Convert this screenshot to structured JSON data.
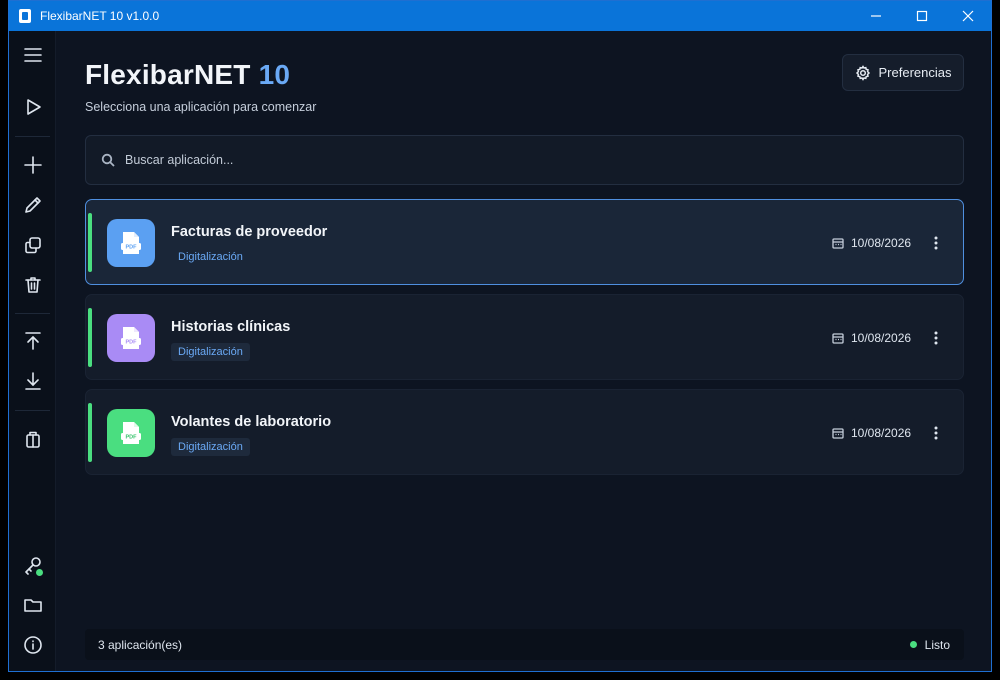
{
  "window": {
    "title": "FlexibarNET 10 v1.0.0"
  },
  "header": {
    "brand_name": "FlexibarNET",
    "brand_version": "10",
    "subtitle": "Selecciona una aplicación para comenzar",
    "preferences_label": "Preferencias"
  },
  "search": {
    "placeholder": "Buscar aplicación..."
  },
  "apps": [
    {
      "name": "Facturas de proveedor",
      "tag": "Digitalización",
      "date": "10/08/2026",
      "icon_color": "#5ba0f2",
      "icon": "pdf-file-icon",
      "selected": true
    },
    {
      "name": "Historias clínicas",
      "tag": "Digitalización",
      "date": "10/08/2026",
      "icon_color": "#a98bf5",
      "icon": "pdf-file-icon",
      "selected": false
    },
    {
      "name": "Volantes de laboratorio",
      "tag": "Digitalización",
      "date": "10/08/2026",
      "icon_color": "#4ade80",
      "icon": "pdf-file-icon",
      "selected": false
    }
  ],
  "statusbar": {
    "count": "3 aplicación(es)",
    "status": "Listo",
    "status_color": "#4ade80"
  },
  "sidebar_icons": [
    "menu-icon",
    "play-icon",
    "plus-icon",
    "pencil-icon",
    "copy-icon",
    "trash-icon",
    "upload-icon",
    "download-icon",
    "package-icon",
    "key-icon",
    "folder-icon",
    "info-icon"
  ],
  "colors": {
    "accent": "#6aa9f5",
    "titlebar": "#0a74d9",
    "success": "#4ade80"
  }
}
